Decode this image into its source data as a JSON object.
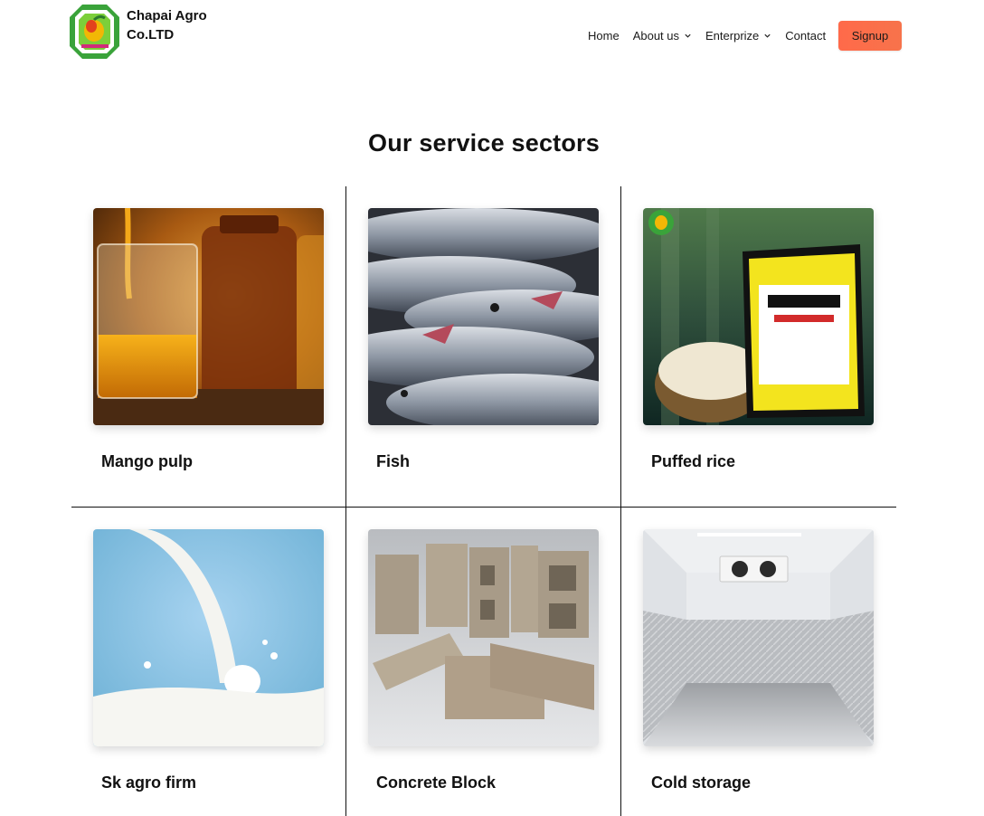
{
  "header": {
    "brand_line1": "Chapai Agro",
    "brand_line2": "Co.LTD",
    "logo_icon": "mango-logo-icon",
    "nav": [
      {
        "label": "Home",
        "dropdown": false
      },
      {
        "label": "About us",
        "dropdown": true
      },
      {
        "label": "Enterprize",
        "dropdown": true
      },
      {
        "label": "Contact",
        "dropdown": false
      }
    ],
    "signup_label": "Signup"
  },
  "main": {
    "title": "Our service sectors",
    "sectors": [
      {
        "label": "Mango pulp",
        "image": "mango-pulp-image"
      },
      {
        "label": "Fish",
        "image": "fish-image"
      },
      {
        "label": "Puffed rice",
        "image": "puffed-rice-image"
      },
      {
        "label": "Sk agro firm",
        "image": "milk-splash-image"
      },
      {
        "label": "Concrete Block",
        "image": "concrete-block-image"
      },
      {
        "label": "Cold storage",
        "image": "cold-storage-image"
      }
    ]
  },
  "colors": {
    "signup_bg": "#f86d4b",
    "logo_green": "#3aa33a",
    "divider": "#111111"
  }
}
